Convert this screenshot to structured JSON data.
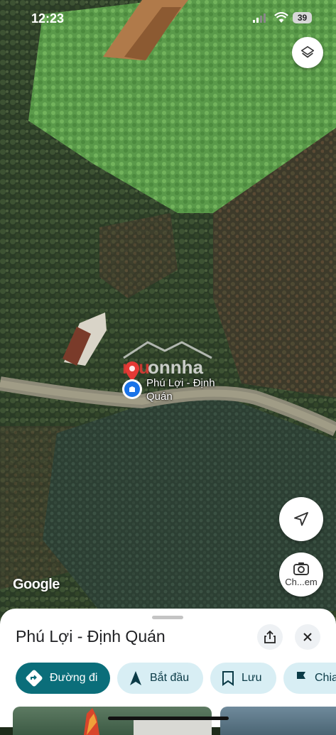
{
  "status_bar": {
    "time": "12:23",
    "battery": "39"
  },
  "map": {
    "place_label": "Phú Lợi - Định Quán",
    "watermark": "muonnha",
    "attribution": "Google",
    "lens_label": "Ch...em",
    "icons": [
      "layers-icon",
      "navigate-arrow-icon",
      "camera-lens-icon",
      "location-pin-icon"
    ]
  },
  "sheet": {
    "title": "Phú Lợi - Định Quán",
    "actions": [
      {
        "label": "Đường đi",
        "icon": "directions-icon"
      },
      {
        "label": "Bắt đầu",
        "icon": "navigation-icon"
      },
      {
        "label": "Lưu",
        "icon": "bookmark-icon"
      },
      {
        "label": "Chia sẻ",
        "icon": "flag-icon"
      }
    ]
  },
  "colors": {
    "primary_chip": "#0b6e7a",
    "chip_bg": "#d8eef4",
    "pin_red": "#e53935",
    "pin_blue": "#1a73e8"
  }
}
